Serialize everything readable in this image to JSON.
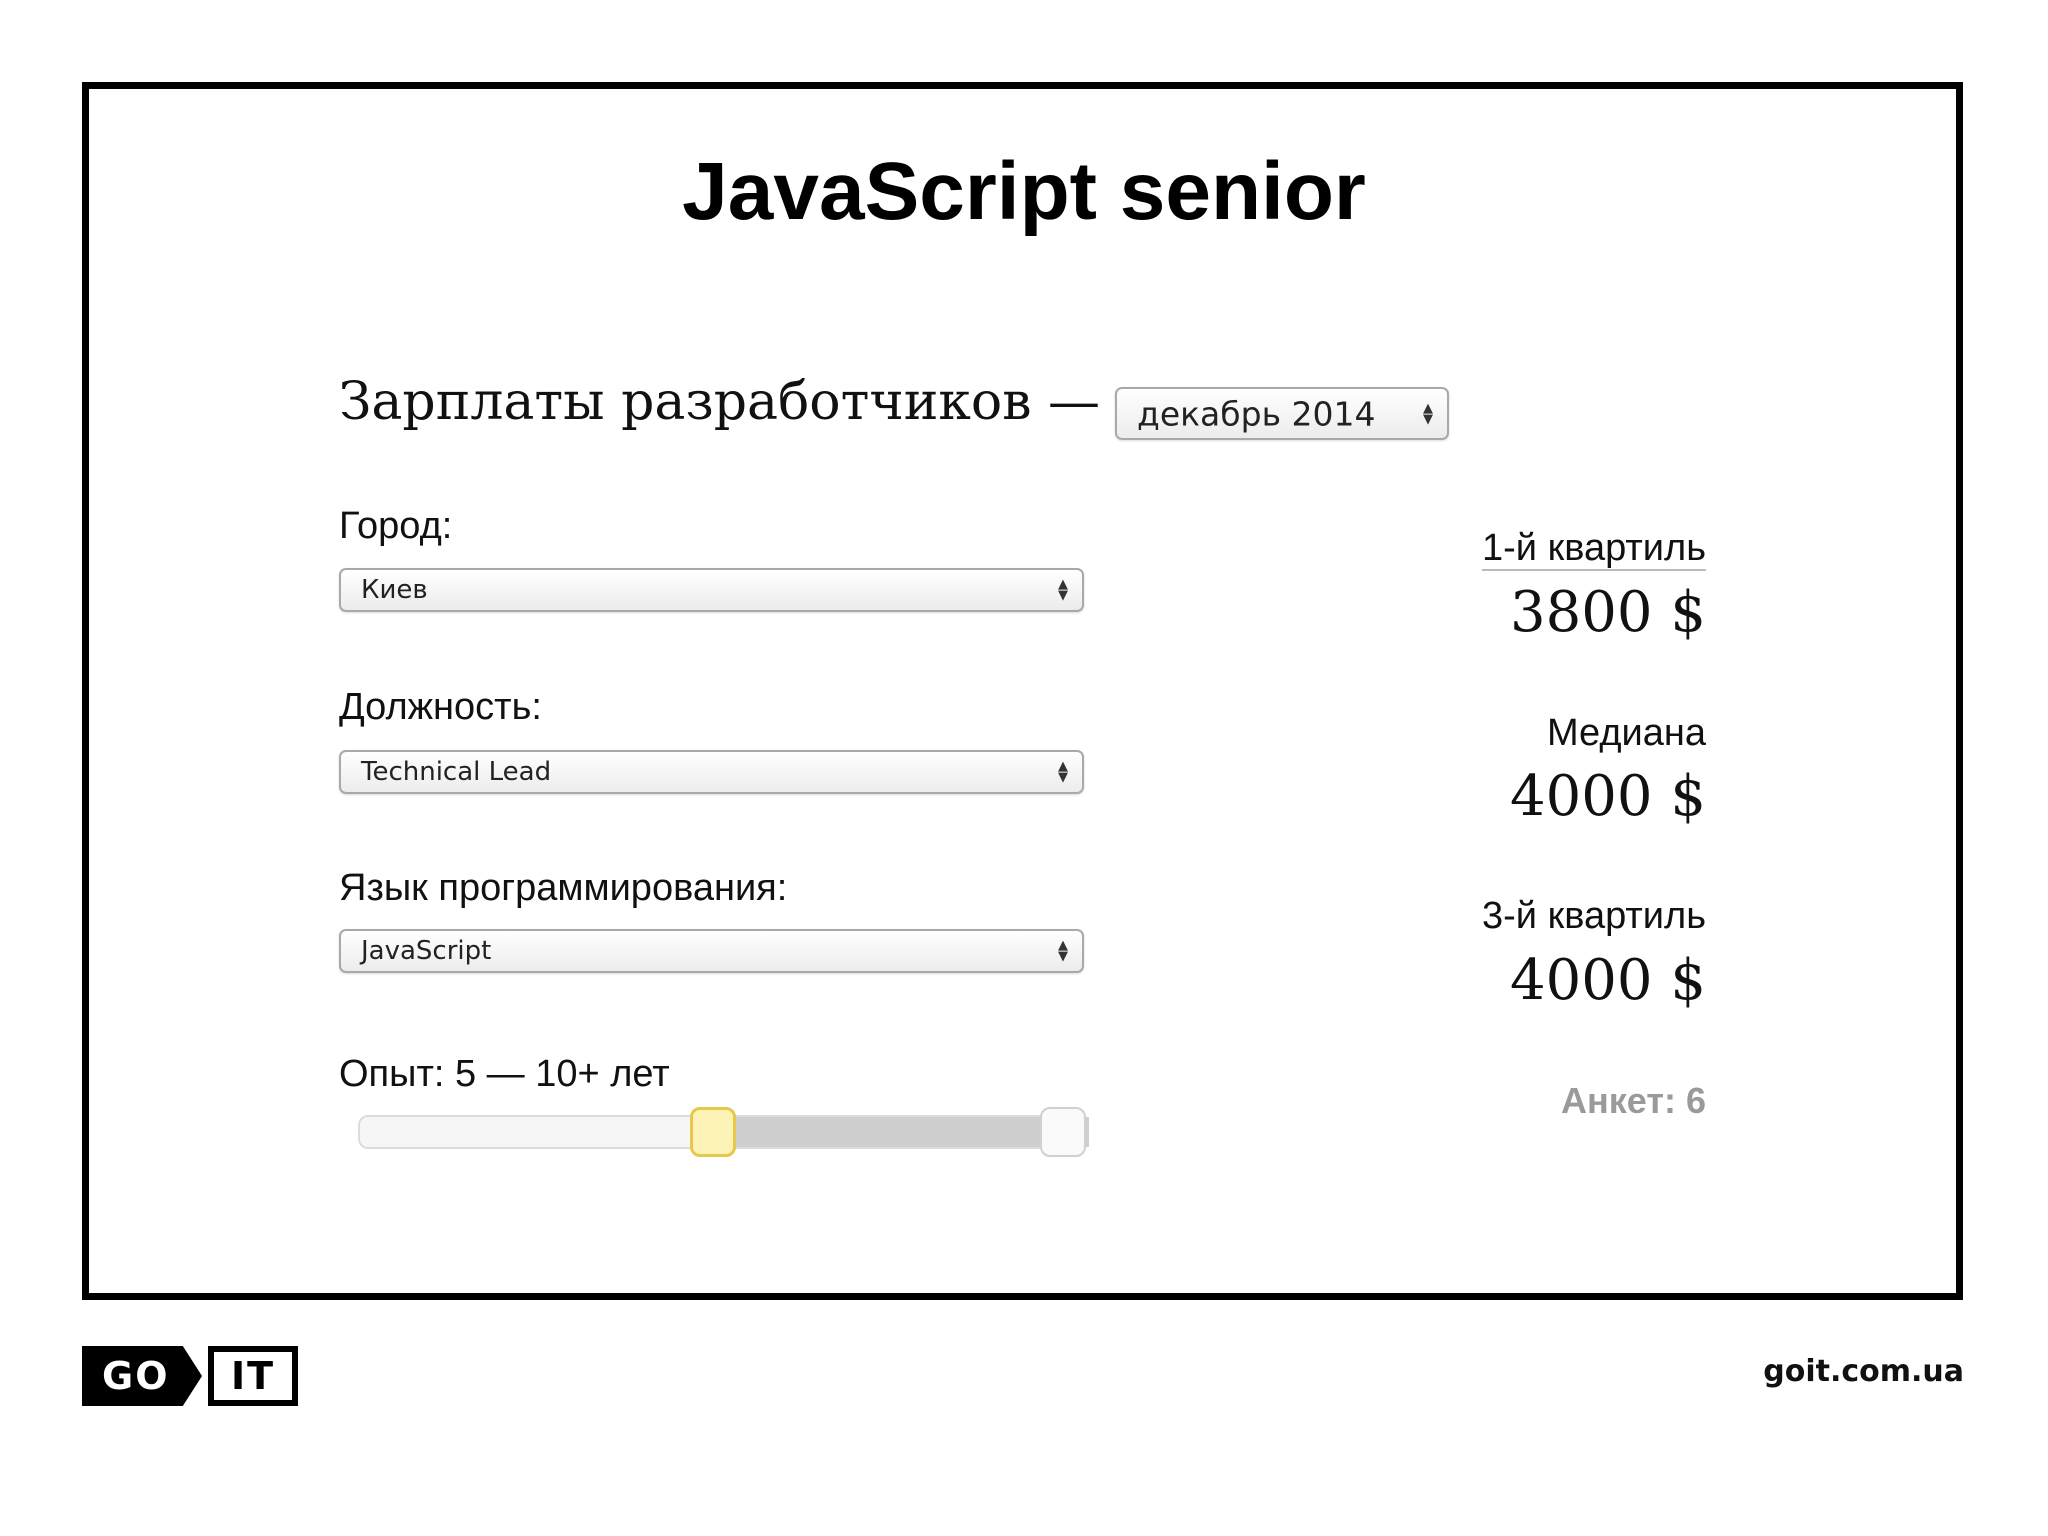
{
  "slide": {
    "title": "JavaScript senior",
    "footer_site": "goit.com.ua",
    "logo": {
      "go": "GO",
      "it": "IT"
    }
  },
  "widget": {
    "heading": "Зарплаты разработчиков —",
    "period": "декабрь 2014",
    "city_label": "Город:",
    "city_value": "Киев",
    "position_label": "Должность:",
    "position_value": "Technical Lead",
    "language_label": "Язык программирования:",
    "language_value": "JavaScript",
    "experience_label": "Опыт: 5 — 10+ лет",
    "experience_range": {
      "min_fraction": 0.5,
      "max_fraction": 1.0
    }
  },
  "stats": {
    "q1_label": "1-й квартиль",
    "q1_value": "3800 $",
    "median_label": "Медиана",
    "median_value": "4000 $",
    "q3_label": "3-й квартиль",
    "q3_value": "4000 $",
    "count": "Анкет: 6"
  },
  "colors": {
    "slider_handle_active": "#fdf3b6",
    "slider_handle_border": "#e8c84a",
    "count_text": "#9a9a9a"
  },
  "icons": {
    "select_arrows": "updown-arrows-icon"
  }
}
